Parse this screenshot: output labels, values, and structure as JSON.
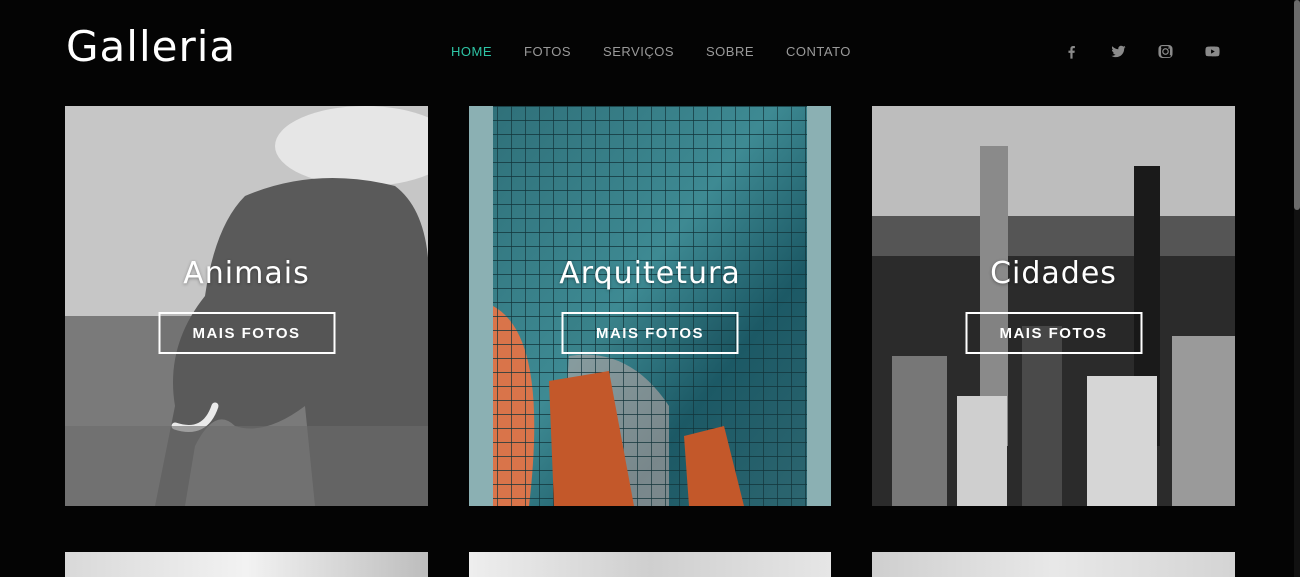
{
  "header": {
    "logo": "Galleria",
    "nav": [
      {
        "label": "HOME",
        "active": true
      },
      {
        "label": "FOTOS",
        "active": false
      },
      {
        "label": "SERVIÇOS",
        "active": false
      },
      {
        "label": "SOBRE",
        "active": false
      },
      {
        "label": "CONTATO",
        "active": false
      }
    ],
    "social": [
      {
        "icon": "facebook-icon"
      },
      {
        "icon": "twitter-icon"
      },
      {
        "icon": "instagram-icon"
      },
      {
        "icon": "youtube-icon"
      }
    ]
  },
  "gallery": {
    "cards": [
      {
        "title": "Animais",
        "button": "MAIS FOTOS"
      },
      {
        "title": "Arquitetura",
        "button": "MAIS FOTOS"
      },
      {
        "title": "Cidades",
        "button": "MAIS FOTOS"
      }
    ]
  },
  "colors": {
    "background": "#040404",
    "accent": "#2ec4a5",
    "nav_text": "#9a9a9a",
    "icon": "#8a8a8a"
  }
}
